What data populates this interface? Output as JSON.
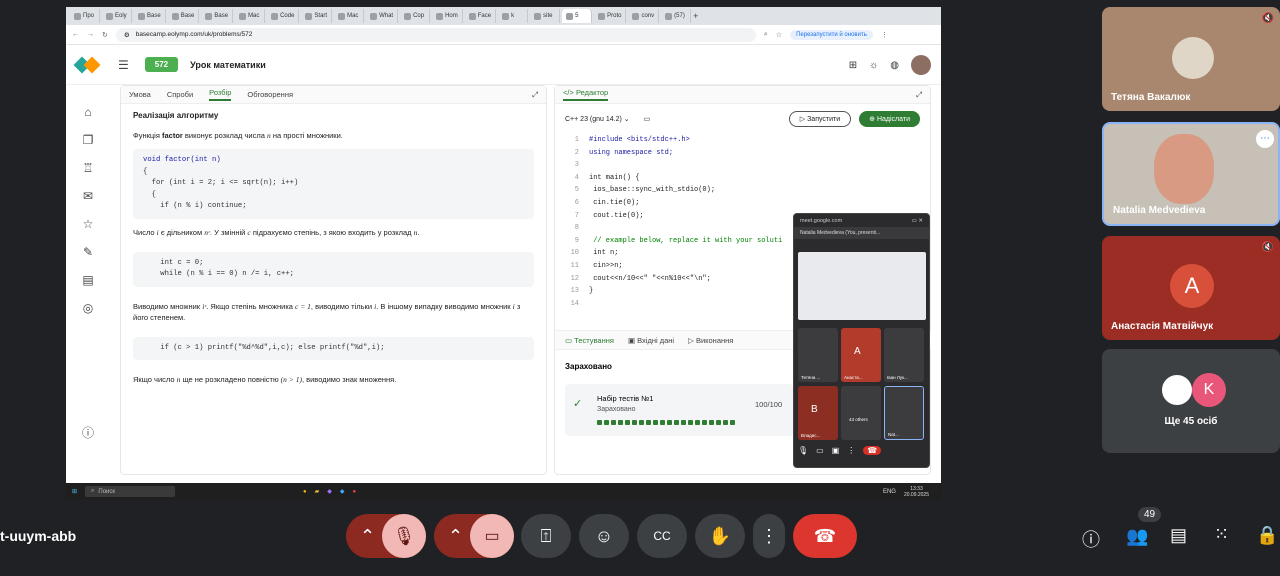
{
  "browser": {
    "tabs": [
      "Про",
      "Eoly",
      "Base",
      "Base",
      "Base",
      "Mac",
      "Code",
      "Start",
      "Mac",
      "What",
      "Cop",
      "Hom",
      "Face",
      "k",
      "site",
      "5",
      "Proto",
      "conv",
      "(57)"
    ],
    "url": "basecamp.eolymp.com/uk/problems/572",
    "relaunch_label": "Перезапустити й оновить"
  },
  "site": {
    "problem_number": "572",
    "problem_title": "Урок математики"
  },
  "left_panel": {
    "tabs": [
      "Умова",
      "Спроби",
      "Розбір",
      "Обговорення"
    ],
    "active_tab": "Розбір",
    "heading": "Реалізація алгоритму",
    "p1_a": "Функція ",
    "p1_fn": "factor",
    "p1_b": " виконує розклад числа ",
    "p1_n": "n",
    "p1_c": " на прості множники.",
    "code1": [
      "void factor(int n)",
      "{",
      "  for (int i = 2; i <= sqrt(n); i++)",
      "  {",
      "    if (n % i) continue;"
    ],
    "p2_a": "Число ",
    "p2_i": "i",
    "p2_b": " є дільником ",
    "p2_nc": "nᶜ",
    "p2_c": ". У змінній ",
    "p2_var": "c",
    "p2_d": " підрахуємо степінь, з якою входить у розклад ",
    "p2_n": "n",
    "p2_e": ".",
    "code2": [
      "    int c = 0;",
      "    while (n % i == 0) n /= i, c++;"
    ],
    "p3_a": "Виводимо множник ",
    "p3_ic": "iᶜ",
    "p3_b": ". Якщо степінь множника ",
    "p3_eq": "c = 1",
    "p3_c": ", виводимо тільки ",
    "p3_i": "i",
    "p3_d": ". В іншому випадку виводимо множник ",
    "p3_i2": "i",
    "p3_e": " з його степенем.",
    "code3": [
      "    if (c > 1) printf(\"%d^%d\",i,c); else printf(\"%d\",i);"
    ],
    "p4_a": "Якщо число ",
    "p4_n": "n",
    "p4_b": " ще не розкладено повністю ",
    "p4_cond": "(n > 1)",
    "p4_c": ", виводимо знак множення."
  },
  "editor": {
    "tab_label": "Редактор",
    "compiler": "C++ 23 (gnu 14.2)",
    "run_label": "Запустити",
    "submit_label": "Надіслати",
    "lines": [
      "#include <bits/stdc++.h>",
      "using namespace std;",
      "",
      "int main() {",
      "    ios_base::sync_with_stdio(0);",
      "    cin.tie(0);",
      "    cout.tie(0);",
      "",
      "    // example below, replace it with your soluti",
      "    int n;",
      "    cin>>n;",
      "    cout<<n/10<<\" \"<<n%10<<\"\\n\";",
      "}",
      ""
    ],
    "bottom_tabs": [
      "Тестування",
      "Вхідні дані",
      "Виконання"
    ],
    "status": "Зараховано",
    "test_name": "Набір тестів №1",
    "test_status": "Зараховано",
    "test_score": "100/100"
  },
  "taskbar": {
    "search_placeholder": "Поиск",
    "lang": "ENG",
    "time": "13:33",
    "date": "20.09.2025"
  },
  "pip": {
    "site": "meet.google.com",
    "presenter": "Natalia Medvedieva (You, presenti...",
    "tiles": [
      "Тетяна ...",
      "Анаста...",
      "Іван Лук...",
      "Владис...",
      "43 others",
      "Nat..."
    ],
    "tile_letters": [
      "A",
      "B"
    ]
  },
  "meet": {
    "participants": [
      {
        "name": "Тетяна Вакалюк"
      },
      {
        "name": "Natalia Medvedieva"
      },
      {
        "name": "Анастасія Матвійчук",
        "letter": "A"
      },
      {
        "name": "Ще 45 осіб",
        "letter": "K"
      }
    ],
    "meeting_code": "t-uuym-abb",
    "people_count": "49"
  }
}
